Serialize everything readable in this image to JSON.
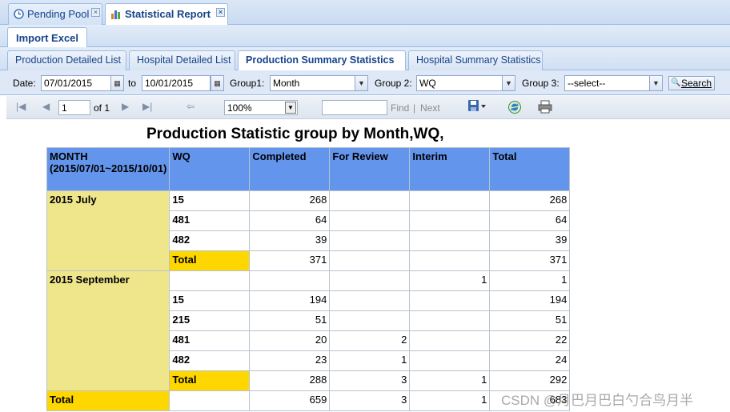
{
  "tabs": [
    {
      "label": "Pending Pool",
      "icon": "clock-icon"
    },
    {
      "label": "Statistical Report",
      "icon": "bar-chart-icon"
    }
  ],
  "import_button": "Import Excel",
  "subtabs": [
    "Production Detailed List",
    "Hospital Detailed List",
    "Production Summary Statistics",
    "Hospital Summary Statistics"
  ],
  "filters": {
    "date_label": "Date:",
    "date_from": "07/01/2015",
    "to_label": "to",
    "date_to": "10/01/2015",
    "group1_label": "Group1:",
    "group1_value": "Month",
    "group2_label": "Group 2:",
    "group2_value": "WQ",
    "group3_label": "Group 3:",
    "group3_value": "--select--",
    "search_label": "Search"
  },
  "report_toolbar": {
    "page_value": "1",
    "of_text": "of 1",
    "zoom_value": "100%",
    "find_label": "Find",
    "separator": "|",
    "next_label": "Next"
  },
  "report": {
    "title": "Production Statistic group by Month,WQ,",
    "columns": [
      "MONTH (2015/07/01~2015/10/01)",
      "WQ",
      "Completed",
      "For Review",
      "Interim",
      "Total"
    ],
    "groups": [
      {
        "month": "2015 July",
        "rows": [
          {
            "wq": "15",
            "completed": "268",
            "review": "",
            "interim": "",
            "total": "268"
          },
          {
            "wq": "481",
            "completed": "64",
            "review": "",
            "interim": "",
            "total": "64"
          },
          {
            "wq": "482",
            "completed": "39",
            "review": "",
            "interim": "",
            "total": "39"
          },
          {
            "wq": "Total",
            "completed": "371",
            "review": "",
            "interim": "",
            "total": "371"
          }
        ]
      },
      {
        "month": "2015 September",
        "rows": [
          {
            "wq": "",
            "completed": "",
            "review": "",
            "interim": "1",
            "total": "1"
          },
          {
            "wq": "15",
            "completed": "194",
            "review": "",
            "interim": "",
            "total": "194"
          },
          {
            "wq": "215",
            "completed": "51",
            "review": "",
            "interim": "",
            "total": "51"
          },
          {
            "wq": "481",
            "completed": "20",
            "review": "2",
            "interim": "",
            "total": "22"
          },
          {
            "wq": "482",
            "completed": "23",
            "review": "1",
            "interim": "",
            "total": "24"
          },
          {
            "wq": "Total",
            "completed": "288",
            "review": "3",
            "interim": "1",
            "total": "292"
          }
        ]
      }
    ],
    "grand_total": {
      "label": "Total",
      "completed": "659",
      "review": "3",
      "interim": "1",
      "total": "683"
    }
  },
  "watermark": "CSDN @月巴月巴白勺合鸟月半",
  "colors": {
    "header_blue": "#6495ed",
    "group_khaki": "#efe68c",
    "total_gold": "#ffd700",
    "ext_border": "#99bbe8"
  }
}
